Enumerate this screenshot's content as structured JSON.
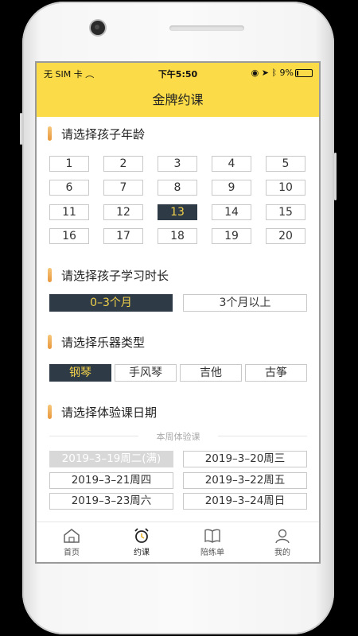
{
  "status_bar": {
    "carrier": "无 SIM 卡",
    "time": "下午5:50",
    "battery": "9%"
  },
  "nav": {
    "title": "金牌约课"
  },
  "age_section": {
    "title": "请选择孩子年龄",
    "options": [
      "1",
      "2",
      "3",
      "4",
      "5",
      "6",
      "7",
      "8",
      "9",
      "10",
      "11",
      "12",
      "13",
      "14",
      "15",
      "16",
      "17",
      "18",
      "19",
      "20"
    ],
    "selected": "13"
  },
  "duration_section": {
    "title": "请选择孩子学习时长",
    "options": [
      "0–3个月",
      "3个月以上"
    ],
    "selected": "0–3个月"
  },
  "instrument_section": {
    "title": "请选择乐器类型",
    "options": [
      "钢琴",
      "手风琴",
      "吉他",
      "古筝"
    ],
    "selected": "钢琴"
  },
  "date_section": {
    "title": "请选择体验课日期",
    "week_label": "本周体验课",
    "dates": [
      {
        "label": "2019–3–19周二(满)",
        "full": true
      },
      {
        "label": "2019–3–20周三",
        "full": false
      },
      {
        "label": "2019–3–21周四",
        "full": false
      },
      {
        "label": "2019–3–22周五",
        "full": false
      },
      {
        "label": "2019–3–23周六",
        "full": false
      },
      {
        "label": "2019–3–24周日",
        "full": false
      }
    ]
  },
  "tabbar": {
    "items": [
      {
        "label": "首页",
        "icon": "home-icon"
      },
      {
        "label": "约课",
        "icon": "alarm-clock-icon"
      },
      {
        "label": "陪练单",
        "icon": "book-icon"
      },
      {
        "label": "我的",
        "icon": "person-icon"
      }
    ],
    "active": "约课"
  },
  "colors": {
    "accent_yellow": "#fbdb47",
    "selected_bg": "#2e3a46",
    "selected_text": "#f2d24b"
  }
}
